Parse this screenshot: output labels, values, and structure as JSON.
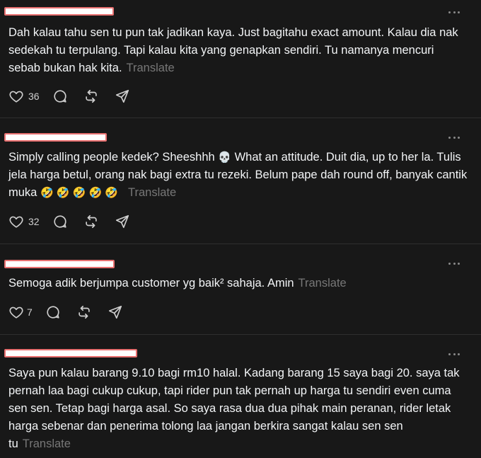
{
  "posts": [
    {
      "text": "Dah kalau tahu sen tu pun tak jadikan kaya. Just bagitahu exact amount. Kalau dia nak sedekah tu terpulang. Tapi kalau kita yang genapkan sendiri. Tu namanya mencuri sebab bukan hak kita.",
      "translate": "Translate",
      "likes": "36"
    },
    {
      "text_a": "Simply calling people kedek? Sheeshhh",
      "skull": "💀",
      "text_b": " What an attitude. Duit dia, up to her la. Tulis jela harga betul, orang nak bagi extra tu rezeki. Belum pape dah round off, banyak cantik muka ",
      "emojis": "🤣 🤣 🤣 🤣 🤣",
      "translate": "Translate",
      "likes": "32"
    },
    {
      "text": "Semoga adik berjumpa customer yg baik² sahaja. Amin",
      "translate": "Translate",
      "likes": "7"
    },
    {
      "text": "Saya pun kalau barang 9.10 bagi rm10 halal. Kadang barang 15 saya bagi 20. saya tak pernah laa bagi cukup cukup, tapi rider pun tak pernah up harga tu sendiri even cuma sen sen. Tetap bagi harga asal. So saya rasa dua dua pihak main peranan, rider letak harga sebenar dan penerima tolong laa jangan berkira sangat kalau sen sen tu",
      "translate": "Translate"
    }
  ],
  "icons": {
    "like": "heart-icon",
    "reply": "comment-icon",
    "repost": "repost-icon",
    "share": "send-icon",
    "more": "more-icon"
  },
  "colors": {
    "background": "#181818",
    "text": "#f3f5f7",
    "muted": "#777777",
    "redaction": "#e87070"
  }
}
